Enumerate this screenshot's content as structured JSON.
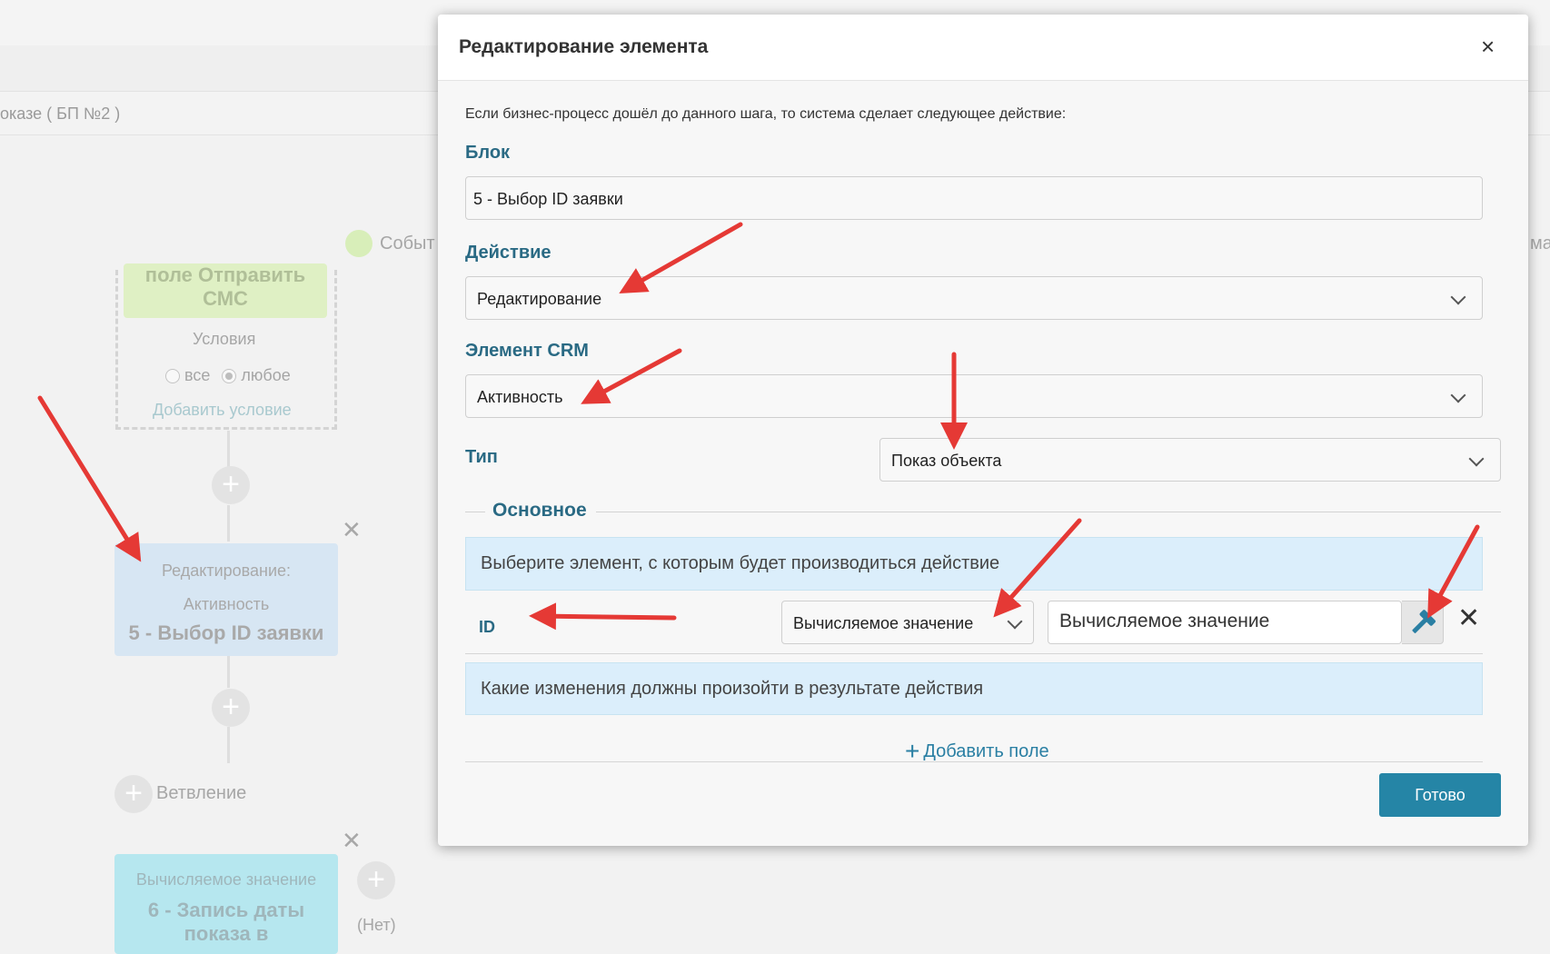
{
  "background": {
    "breadcrumb": "оказе ( БП №2 )",
    "event_label": "Событ",
    "right_cut_label": "ма",
    "condition_block": {
      "card_title": "поле Отправить СМС",
      "conditions_label": "Условия",
      "radio_all": "все",
      "radio_any": "любое",
      "add_condition": "Добавить условие"
    },
    "edit_card": {
      "line1": "Редактирование:",
      "line2": "Активность",
      "title": "5 - Выбор ID заявки"
    },
    "branch_label": "Ветвление",
    "calc_card": {
      "line1": "Вычисляемое значение",
      "title": "6 - Запись даты показа в"
    },
    "no_label": "(Нет)"
  },
  "modal": {
    "title": "Редактирование элемента",
    "close_icon": "×",
    "intro": "Если бизнес-процесс дошёл до данного шага, то система сделает следующее действие:",
    "block_label": "Блок",
    "block_value": "5 - Выбор ID заявки",
    "action_label": "Действие",
    "action_value": "Редактирование",
    "crm_label": "Элемент CRM",
    "crm_value": "Активность",
    "type_label": "Тип",
    "type_value": "Показ объекта",
    "section_title": "Основное",
    "select_element_info": "Выберите элемент, с которым будет производиться действие",
    "id_label": "ID",
    "id_mode_value": "Вычисляемое значение",
    "id_calc_value": "Вычисляемое значение",
    "remove_icon": "✕",
    "changes_info": "Какие изменения должны произойти в результате действия",
    "add_field": "Добавить поле",
    "add_icon": "+",
    "done_button": "Готово"
  },
  "colors": {
    "accent": "#2585a6",
    "label": "#2a6a84",
    "info_bg": "#dbeefb",
    "annotation_arrow": "#e53935"
  }
}
